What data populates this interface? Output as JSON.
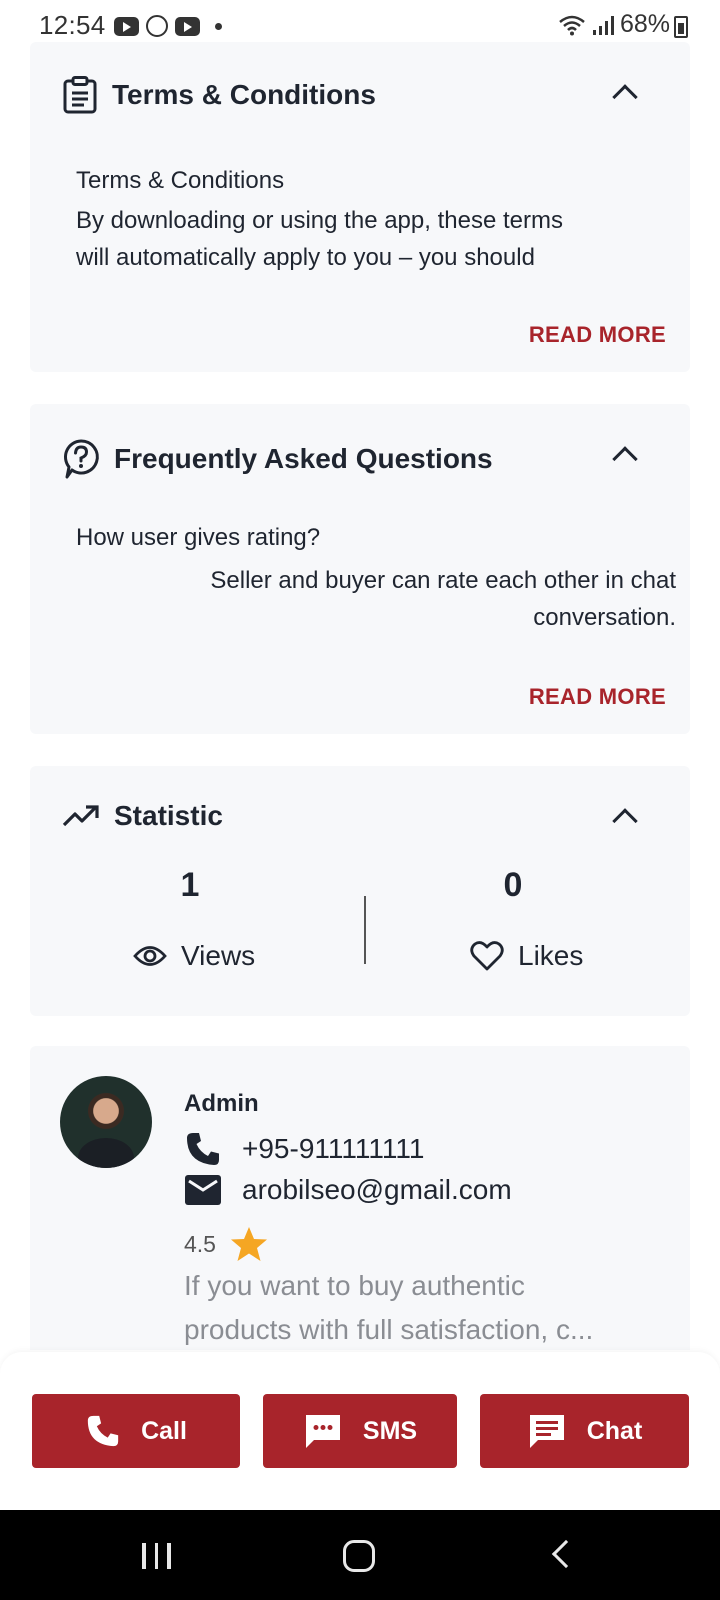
{
  "status_bar": {
    "time": "12:54",
    "battery": "68%"
  },
  "terms": {
    "title": "Terms & Conditions",
    "body_title": "Terms & Conditions",
    "body_line1": "By downloading or using the app, these terms",
    "body_line2": "will automatically apply to you – you should",
    "read_more": "READ MORE"
  },
  "faq": {
    "title": "Frequently Asked Questions",
    "question": "How user gives rating?",
    "answer_line1": "Seller and buyer can rate each other in chat",
    "answer_line2": "conversation.",
    "read_more": "READ MORE"
  },
  "statistic": {
    "title": "Statistic",
    "views_count": "1",
    "views_label": "Views",
    "likes_count": "0",
    "likes_label": "Likes"
  },
  "seller": {
    "name": "Admin",
    "phone": "+95-911111111",
    "email": "arobilseo@gmail.com",
    "rating": "4.5",
    "description_line1": "If you want to buy authentic",
    "description_line2": "products with full satisfaction, c..."
  },
  "actions": {
    "call": "Call",
    "sms": "SMS",
    "chat": "Chat"
  },
  "colors": {
    "accent": "#a8242b",
    "card_bg": "#f7f8fa",
    "star": "#f5a623"
  }
}
